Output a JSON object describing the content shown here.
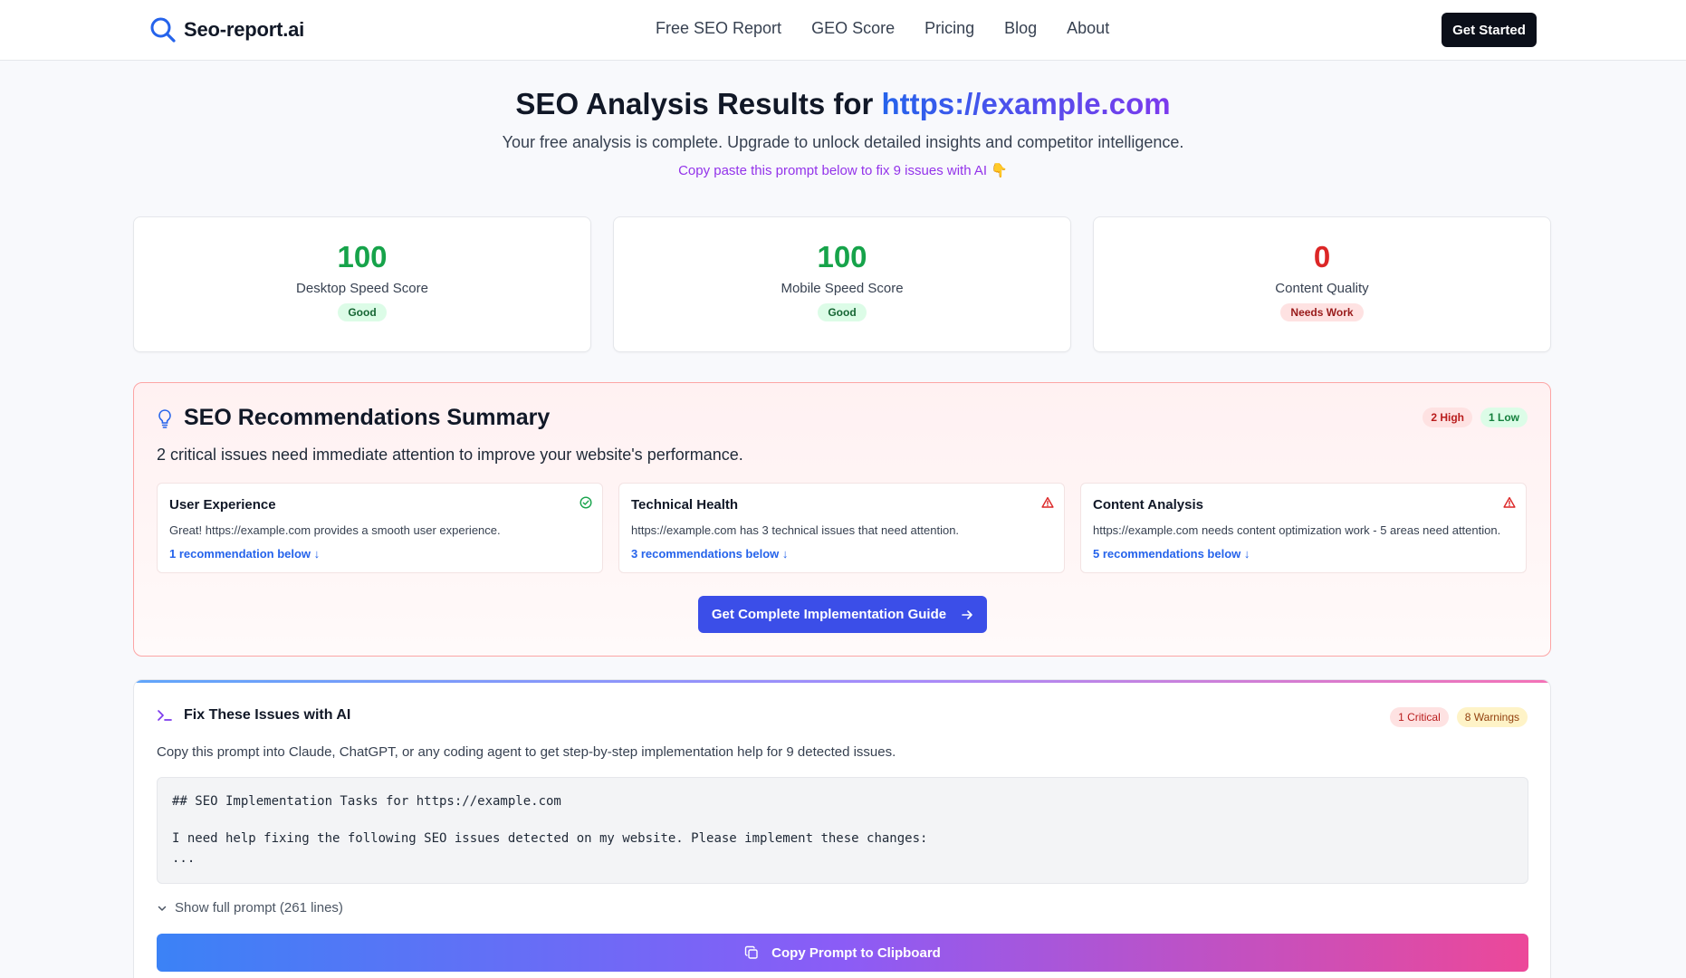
{
  "nav": {
    "logo": "Seo-report.ai",
    "links": [
      "Free SEO Report",
      "GEO Score",
      "Pricing",
      "Blog",
      "About"
    ],
    "cta": "Get Started"
  },
  "hero": {
    "title_prefix": "SEO Analysis Results for ",
    "url": "https://example.com",
    "subtitle": "Your free analysis is complete. Upgrade to unlock detailed insights and competitor intelligence.",
    "prompt_note": "Copy paste this prompt below to fix 9 issues with AI",
    "prompt_emoji": "👇"
  },
  "scores": [
    {
      "value": "100",
      "label": "Desktop Speed Score",
      "badge": "Good",
      "color": "#16a34a"
    },
    {
      "value": "100",
      "label": "Mobile Speed Score",
      "badge": "Good",
      "color": "#16a34a"
    },
    {
      "value": "0",
      "label": "Content Quality",
      "badge": "Needs Work",
      "color": "#dc2626"
    }
  ],
  "summary": {
    "title": "SEO Recommendations Summary",
    "high_pill": "2 High",
    "low_pill": "1 Low",
    "description": "2 critical issues need immediate attention to improve your website's performance.",
    "categories": [
      {
        "title": "User Experience",
        "icon": "check-circle-icon",
        "desc": "Great! https://example.com provides a smooth user experience.",
        "link": "1 recommendation below ↓"
      },
      {
        "title": "Technical Health",
        "icon": "warning-triangle-icon",
        "desc": "https://example.com has 3 technical issues that need attention.",
        "link": "3 recommendations below ↓"
      },
      {
        "title": "Content Analysis",
        "icon": "warning-triangle-icon",
        "desc": "https://example.com needs content optimization work - 5 areas need attention.",
        "link": "5 recommendations below ↓"
      }
    ],
    "guide_button": "Get Complete Implementation Guide"
  },
  "fix": {
    "title": "Fix These Issues with AI",
    "critical_pill": "1 Critical",
    "warnings_pill": "8 Warnings",
    "description": "Copy this prompt into Claude, ChatGPT, or any coding agent to get step-by-step implementation help for 9 detected issues.",
    "code_lines": [
      "## SEO Implementation Tasks for https://example.com",
      "I need help fixing the following SEO issues detected on my website. Please implement these changes:",
      "..."
    ],
    "show_full": "Show full prompt (261 lines)",
    "copy_button": "Copy Prompt to Clipboard"
  },
  "colors": {
    "accent_blue": "#2563eb",
    "accent_purple": "#7c3aed",
    "good": "#16a34a",
    "bad": "#dc2626",
    "warning": "#d97706"
  }
}
